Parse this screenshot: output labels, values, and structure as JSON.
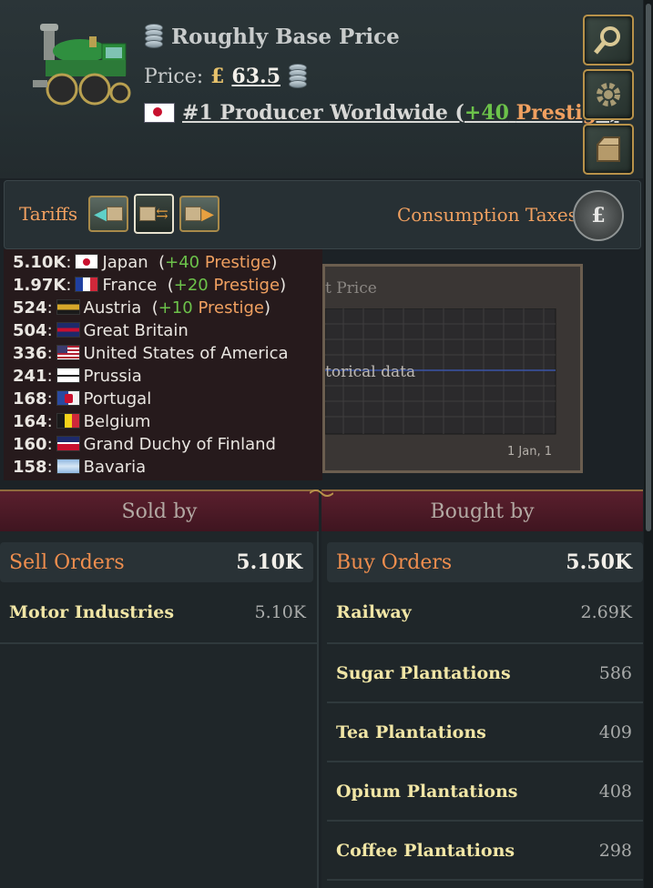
{
  "good": {
    "price_status": "Roughly Base Price",
    "price_label": "Price:",
    "currency_symbol": "£",
    "price_value": "63.5",
    "producer_rank": "#1 Producer Worldwide (",
    "producer_prestige": "+40",
    "producer_prestige_word": "Prestige",
    "producer_close": ")"
  },
  "tariffs": {
    "label": "Tariffs",
    "consumption_label": "Consumption Taxes",
    "selected_index": 1
  },
  "producers": [
    {
      "amount": "5.10K",
      "country": "Japan",
      "prestige": "+40",
      "prestige_word": "Prestige",
      "flag": "japan-flag"
    },
    {
      "amount": "1.97K",
      "country": "France",
      "prestige": "+20",
      "prestige_word": "Prestige",
      "flag": "france-flag"
    },
    {
      "amount": "524",
      "country": "Austria",
      "prestige": "+10",
      "prestige_word": "Prestige",
      "flag": "austria-flag"
    },
    {
      "amount": "504",
      "country": "Great Britain",
      "flag": "great-britain-flag"
    },
    {
      "amount": "336",
      "country": "United States of America",
      "flag": "usa-flag"
    },
    {
      "amount": "241",
      "country": "Prussia",
      "flag": "prussia-flag"
    },
    {
      "amount": "168",
      "country": "Portugal",
      "flag": "portugal-flag"
    },
    {
      "amount": "164",
      "country": "Belgium",
      "flag": "belgium-flag"
    },
    {
      "amount": "160",
      "country": "Grand Duchy of Finland",
      "flag": "finland-flag"
    },
    {
      "amount": "158",
      "country": "Bavaria",
      "flag": "bavaria-flag"
    }
  ],
  "chart": {
    "title_fragment": "t Price",
    "empty_fragment": "torical data",
    "date_label": "1 Jan, 1"
  },
  "sold_by": {
    "title": "Sold by",
    "orders_label": "Sell Orders",
    "orders_total": "5.10K",
    "rows": [
      {
        "name": "Motor Industries",
        "value": "5.10K"
      }
    ]
  },
  "bought_by": {
    "title": "Bought by",
    "orders_label": "Buy Orders",
    "orders_total": "5.50K",
    "rows": [
      {
        "name": "Railway",
        "value": "2.69K"
      },
      {
        "name": "Sugar Plantations",
        "value": "586"
      },
      {
        "name": "Tea Plantations",
        "value": "409"
      },
      {
        "name": "Opium Plantations",
        "value": "408"
      },
      {
        "name": "Coffee Plantations",
        "value": "298"
      }
    ]
  },
  "colors": {
    "accent_orange": "#ef8e4e",
    "prestige_green": "#6cc24a",
    "gold_text": "#e8c36c",
    "section_maroon": "#5a1f2d"
  }
}
